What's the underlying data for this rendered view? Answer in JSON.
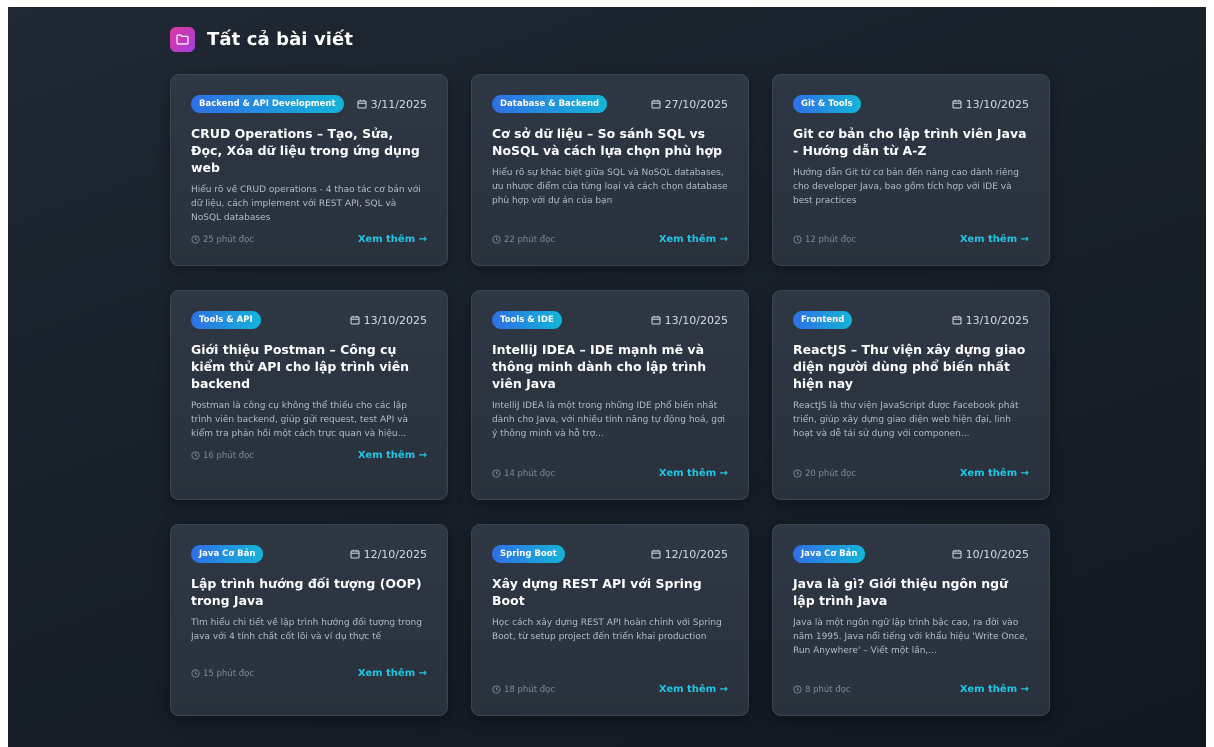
{
  "section": {
    "title": "Tất cả bài viết",
    "icon": "folder-icon"
  },
  "colors": {
    "accent": "#21c6e6",
    "tag_start": "#2f6fe6",
    "tag_end": "#14b5d8",
    "folder_start": "#e0369a",
    "folder_end": "#a23fe0",
    "background": "#18202a",
    "card": "#2b333e"
  },
  "posts": [
    {
      "tag": "Backend & API Development",
      "date": "3/11/2025",
      "title": "CRUD Operations – Tạo, Sửa, Đọc, Xóa dữ liệu trong ứng dụng web",
      "excerpt": "Hiểu rõ về CRUD operations - 4 thao tác cơ bản với dữ liệu, cách implement với REST API, SQL và NoSQL databases",
      "read_time": "25 phút đọc",
      "more_label": "Xem thêm →"
    },
    {
      "tag": "Database & Backend",
      "date": "27/10/2025",
      "title": "Cơ sở dữ liệu – So sánh SQL vs NoSQL và cách lựa chọn phù hợp",
      "excerpt": "Hiểu rõ sự khác biệt giữa SQL và NoSQL databases, ưu nhược điểm của từng loại và cách chọn database phù hợp với dự án của bạn",
      "read_time": "22 phút đọc",
      "more_label": "Xem thêm →"
    },
    {
      "tag": "Git & Tools",
      "date": "13/10/2025",
      "title": "Git cơ bản cho lập trình viên Java - Hướng dẫn từ A-Z",
      "excerpt": "Hướng dẫn Git từ cơ bản đến nâng cao dành riêng cho developer Java, bao gồm tích hợp với IDE và best practices",
      "read_time": "12 phút đọc",
      "more_label": "Xem thêm →"
    },
    {
      "tag": "Tools & API",
      "date": "13/10/2025",
      "title": "Giới thiệu Postman – Công cụ kiểm thử API cho lập trình viên backend",
      "excerpt": "Postman là công cụ không thể thiếu cho các lập trình viên backend, giúp gửi request, test API và kiểm tra phản hồi một cách trực quan và hiệu...",
      "read_time": "16 phút đọc",
      "more_label": "Xem thêm →"
    },
    {
      "tag": "Tools & IDE",
      "date": "13/10/2025",
      "title": "IntelliJ IDEA – IDE mạnh mẽ và thông minh dành cho lập trình viên Java",
      "excerpt": "IntelliJ IDEA là một trong những IDE phổ biến nhất dành cho Java, với nhiều tính năng tự động hoá, gợi ý thông minh và hỗ trợ...",
      "read_time": "14 phút đọc",
      "more_label": "Xem thêm →"
    },
    {
      "tag": "Frontend",
      "date": "13/10/2025",
      "title": "ReactJS – Thư viện xây dựng giao diện người dùng phổ biến nhất hiện nay",
      "excerpt": "ReactJS là thư viện JavaScript được Facebook phát triển, giúp xây dựng giao diện web hiện đại, linh hoạt và dễ tái sử dụng với componen...",
      "read_time": "20 phút đọc",
      "more_label": "Xem thêm →"
    },
    {
      "tag": "Java Cơ Bản",
      "date": "12/10/2025",
      "title": "Lập trình hướng đối tượng (OOP) trong Java",
      "excerpt": "Tìm hiểu chi tiết về lập trình hướng đối tượng trong Java với 4 tính chất cốt lõi và ví dụ thực tế",
      "read_time": "15 phút đọc",
      "more_label": "Xem thêm →"
    },
    {
      "tag": "Spring Boot",
      "date": "12/10/2025",
      "title": "Xây dựng REST API với Spring Boot",
      "excerpt": "Học cách xây dựng REST API hoàn chỉnh với Spring Boot, từ setup project đến triển khai production",
      "read_time": "18 phút đọc",
      "more_label": "Xem thêm →"
    },
    {
      "tag": "Java Cơ Bản",
      "date": "10/10/2025",
      "title": "Java là gì? Giới thiệu ngôn ngữ lập trình Java",
      "excerpt": "Java là một ngôn ngữ lập trình bậc cao, ra đời vào năm 1995. Java nổi tiếng với khẩu hiệu 'Write Once, Run Anywhere' – Viết một lần,...",
      "read_time": "8 phút đọc",
      "more_label": "Xem thêm →"
    }
  ]
}
